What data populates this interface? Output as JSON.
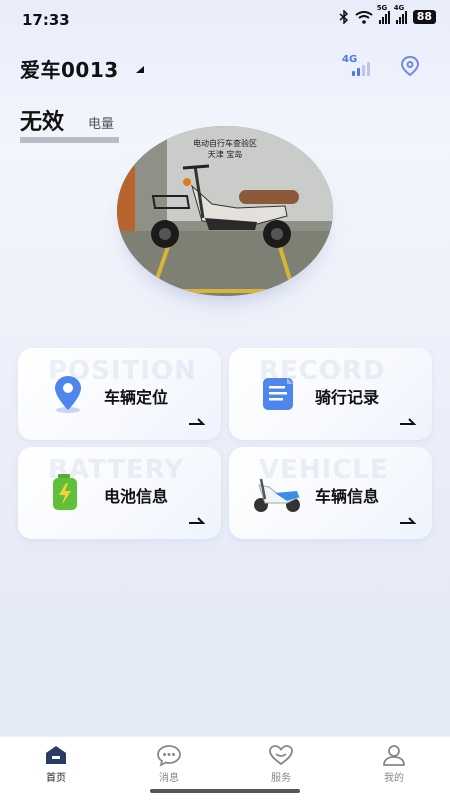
{
  "status_bar": {
    "time": "17:33",
    "net1": "5G",
    "net2": "4G",
    "battery": "88"
  },
  "header": {
    "vehicle_name": "爱车0013",
    "network_label": "4G"
  },
  "power": {
    "status": "无效",
    "label": "电量",
    "level": 0
  },
  "photo": {
    "caption_line1": "电动自行车查验区",
    "caption_line2": "天津 宝岛"
  },
  "cards": [
    {
      "label": "车辆定位",
      "watermark": "POSITION"
    },
    {
      "label": "骑行记录",
      "watermark": "RECORD"
    },
    {
      "label": "电池信息",
      "watermark": "BATTERY"
    },
    {
      "label": "车辆信息",
      "watermark": "VEHICLE"
    }
  ],
  "tabs": [
    {
      "label": "首页",
      "active": true
    },
    {
      "label": "消息",
      "active": false
    },
    {
      "label": "服务",
      "active": false
    },
    {
      "label": "我的",
      "active": false
    }
  ],
  "colors": {
    "accent": "#4a78e8",
    "active_tab": "#2a3b66"
  }
}
